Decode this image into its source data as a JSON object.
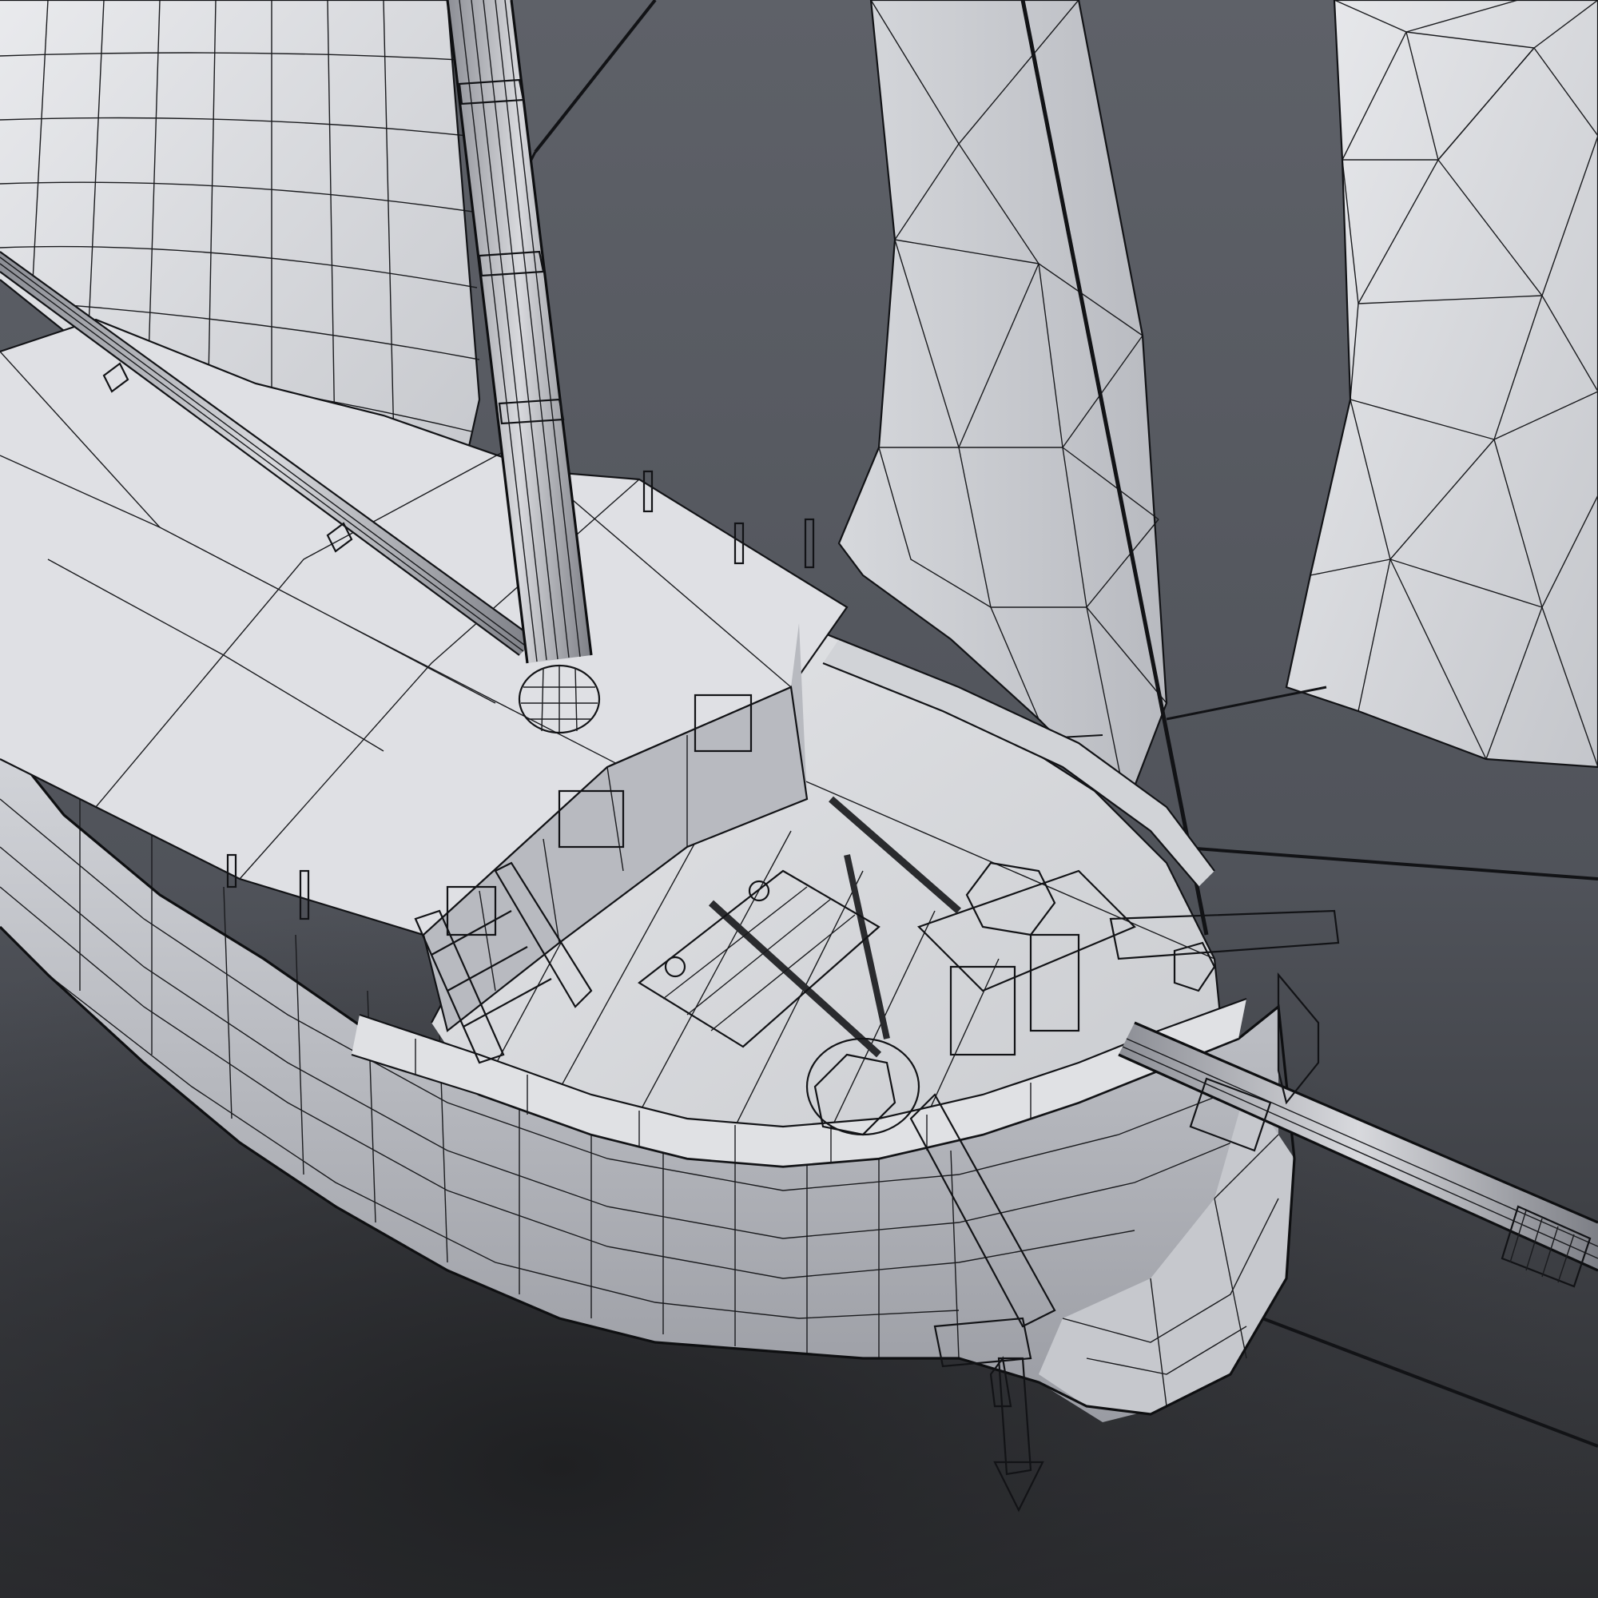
{
  "scene": {
    "subject": "",
    "colors": {
      "background_top": "#5c5f66",
      "background_bottom": "#2a2b2e",
      "surface_light": "#dcdde1",
      "surface_mid": "#b9bbc1",
      "surface_dark": "#8e9097",
      "wire": "#121316"
    }
  }
}
